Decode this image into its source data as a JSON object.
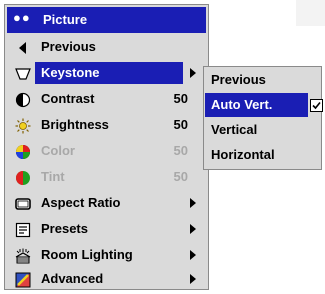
{
  "menu": {
    "title": "Picture",
    "items": [
      {
        "name": "previous",
        "label": "Previous",
        "icon": "left-arrow-icon"
      },
      {
        "name": "keystone",
        "label": "Keystone",
        "icon": "keystone-icon",
        "selected": true,
        "has_submenu": true
      },
      {
        "name": "contrast",
        "label": "Contrast",
        "icon": "contrast-icon",
        "value": "50"
      },
      {
        "name": "brightness",
        "label": "Brightness",
        "icon": "brightness-icon",
        "value": "50"
      },
      {
        "name": "color",
        "label": "Color",
        "icon": "color-icon",
        "value": "50",
        "disabled": true
      },
      {
        "name": "tint",
        "label": "Tint",
        "icon": "tint-icon",
        "value": "50",
        "disabled": true
      },
      {
        "name": "aspect-ratio",
        "label": "Aspect Ratio",
        "icon": "aspect-ratio-icon",
        "has_submenu": true
      },
      {
        "name": "presets",
        "label": "Presets",
        "icon": "presets-icon",
        "has_submenu": true
      },
      {
        "name": "room-lighting",
        "label": "Room Lighting",
        "icon": "room-lighting-icon",
        "has_submenu": true
      },
      {
        "name": "advanced",
        "label": "Advanced",
        "icon": "advanced-icon",
        "has_submenu": true
      }
    ]
  },
  "submenu": {
    "items": [
      {
        "name": "previous",
        "label": "Previous"
      },
      {
        "name": "auto-vert",
        "label": "Auto Vert.",
        "selected": true,
        "checked": true
      },
      {
        "name": "vertical",
        "label": "Vertical"
      },
      {
        "name": "horizontal",
        "label": "Horizontal"
      }
    ]
  },
  "colors": {
    "highlight": "#1a1eb4",
    "menu_bg": "#dadada",
    "disabled_text": "#a8a8a8"
  }
}
